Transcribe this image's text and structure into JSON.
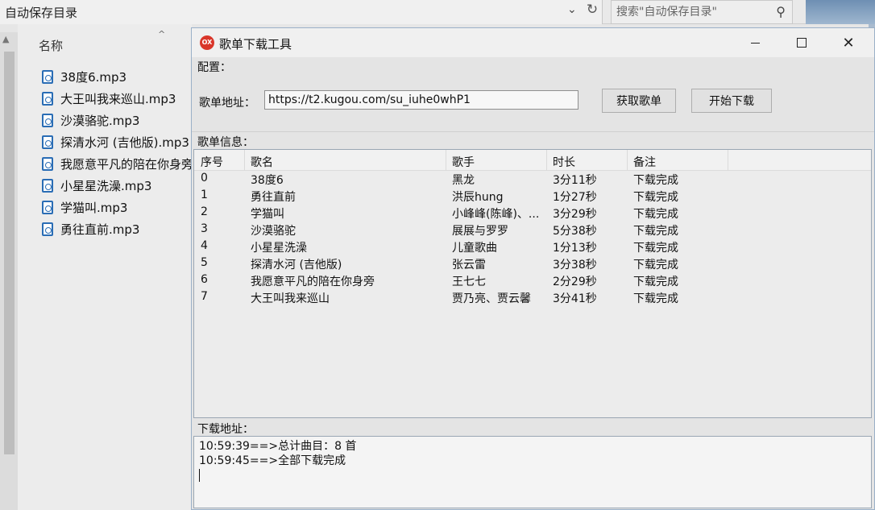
{
  "explorer": {
    "path": "自动保存目录",
    "search_placeholder": "搜索\"自动保存目录\"",
    "column_name": "名称",
    "files": [
      "38度6.mp3",
      "大王叫我来巡山.mp3",
      "沙漠骆驼.mp3",
      "探清水河 (吉他版).mp3",
      "我愿意平凡的陪在你身旁",
      "小星星洗澡.mp3",
      "学猫叫.mp3",
      "勇往直前.mp3"
    ]
  },
  "window": {
    "icon_text": "OX",
    "title": "歌单下载工具",
    "config_label": "配置：",
    "playlist_url_label": "歌单地址：",
    "playlist_url_value": "https://t2.kugou.com/su_iuhe0whP1",
    "fetch_button": "获取歌单",
    "download_button": "开始下载",
    "playlist_info_label": "歌单信息：",
    "columns": [
      "序号",
      "歌名",
      "歌手",
      "时长",
      "备注"
    ],
    "rows": [
      {
        "no": "0",
        "title": "38度6",
        "artist": "黑龙",
        "duration": "3分11秒",
        "note": "下载完成"
      },
      {
        "no": "1",
        "title": "勇往直前",
        "artist": "洪辰hung",
        "duration": "1分27秒",
        "note": "下载完成"
      },
      {
        "no": "2",
        "title": "学猫叫",
        "artist": "小峰峰(陈峰)、...",
        "duration": "3分29秒",
        "note": "下载完成"
      },
      {
        "no": "3",
        "title": "沙漠骆驼",
        "artist": "展展与罗罗",
        "duration": "5分38秒",
        "note": "下载完成"
      },
      {
        "no": "4",
        "title": "小星星洗澡",
        "artist": "儿童歌曲",
        "duration": "1分13秒",
        "note": "下载完成"
      },
      {
        "no": "5",
        "title": "探清水河 (吉他版)",
        "artist": "张云雷",
        "duration": "3分38秒",
        "note": "下载完成"
      },
      {
        "no": "6",
        "title": "我愿意平凡的陪在你身旁",
        "artist": "王七七",
        "duration": "2分29秒",
        "note": "下载完成"
      },
      {
        "no": "7",
        "title": "大王叫我来巡山",
        "artist": "贾乃亮、贾云馨",
        "duration": "3分41秒",
        "note": "下载完成"
      }
    ],
    "download_addr_label": "下载地址：",
    "log_lines": [
      "10:59:39==>总计曲目：8 首",
      "10:59:45==>全部下载完成"
    ]
  }
}
